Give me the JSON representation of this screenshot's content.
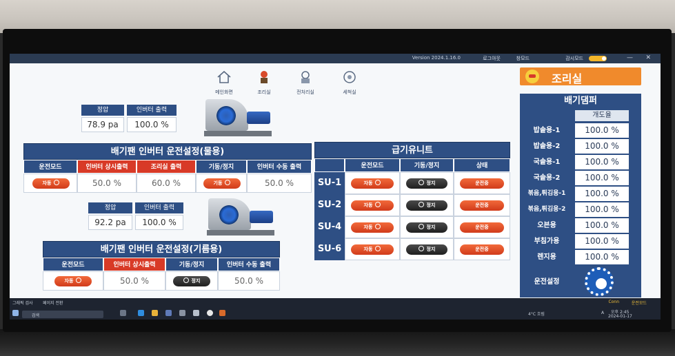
{
  "window": {
    "version": "Version 2024.1.16.0",
    "logout": "로그아웃",
    "screen_mode": "창모드",
    "monitor_mode": "감시모드"
  },
  "nav": {
    "items": [
      {
        "label": "메인화면"
      },
      {
        "label": "조리실"
      },
      {
        "label": "전처리실"
      },
      {
        "label": "세척실"
      }
    ]
  },
  "badge": {
    "title": "조리실"
  },
  "water_fan": {
    "static_pressure_label": "정압",
    "static_pressure_value": "78.9 pa",
    "inverter_output_label": "인버터 출력",
    "inverter_output_value": "100.0 %",
    "title": "배기팬 인버터 운전설정(물용)",
    "headers": [
      "운전모드",
      "인버터 상시출력",
      "조리실 출력",
      "기동/정지",
      "인버터 수동 출력"
    ],
    "mode": "자동",
    "constant_output": "50.0 %",
    "room_output": "60.0 %",
    "start_stop": "기동",
    "manual_output": "50.0 %"
  },
  "oil_fan": {
    "static_pressure_label": "정압",
    "static_pressure_value": "92.2 pa",
    "inverter_output_label": "인버터 출력",
    "inverter_output_value": "100.0 %",
    "title": "배기팬 인버터 운전설정(기름용)",
    "headers": [
      "운전모드",
      "인버터 상시출력",
      "기동/정지",
      "인버터 수동 출력"
    ],
    "mode": "자동",
    "constant_output": "50.0 %",
    "start_stop": "정지",
    "manual_output": "50.0 %"
  },
  "supply_unit": {
    "title": "급기유니트",
    "headers": [
      "운전모드",
      "기동/정지",
      "상태"
    ],
    "rows": [
      {
        "name": "SU-1",
        "mode": "자동",
        "start_stop": "정지",
        "status": "운전중"
      },
      {
        "name": "SU-2",
        "mode": "자동",
        "start_stop": "정지",
        "status": "운전중"
      },
      {
        "name": "SU-4",
        "mode": "자동",
        "start_stop": "정지",
        "status": "운전중"
      },
      {
        "name": "SU-6",
        "mode": "자동",
        "start_stop": "정지",
        "status": "운전중"
      }
    ]
  },
  "damper": {
    "title": "배기댐퍼",
    "column_header": "개도율",
    "rows": [
      {
        "label": "밥솥용-1",
        "value": "100.0 %"
      },
      {
        "label": "밥솥용-2",
        "value": "100.0 %"
      },
      {
        "label": "국솥용-1",
        "value": "100.0 %"
      },
      {
        "label": "국솥용-2",
        "value": "100.0 %"
      },
      {
        "label": "볶음,튀김용-1",
        "value": "100.0 %"
      },
      {
        "label": "볶음,튀김용-2",
        "value": "100.0 %"
      },
      {
        "label": "오븐용",
        "value": "100.0 %"
      },
      {
        "label": "부침가용",
        "value": "100.0 %"
      },
      {
        "label": "렌지용",
        "value": "100.0 %"
      }
    ],
    "settings_label": "운전설정"
  },
  "taskbar": {
    "search": "검색",
    "weather": "4°C 흐림",
    "lang": "A",
    "time": "오후 2:45",
    "date": "2024-01-17",
    "left_links": [
      "그래픽 검사",
      "페이지 전환"
    ],
    "right_status": [
      "Conn",
      "운전모드"
    ]
  },
  "colors": {
    "header_blue": "#2e4f84",
    "accent_red": "#d83a27",
    "accent_orange": "#f08a2c",
    "pill_dark": "#1f1f1f"
  }
}
